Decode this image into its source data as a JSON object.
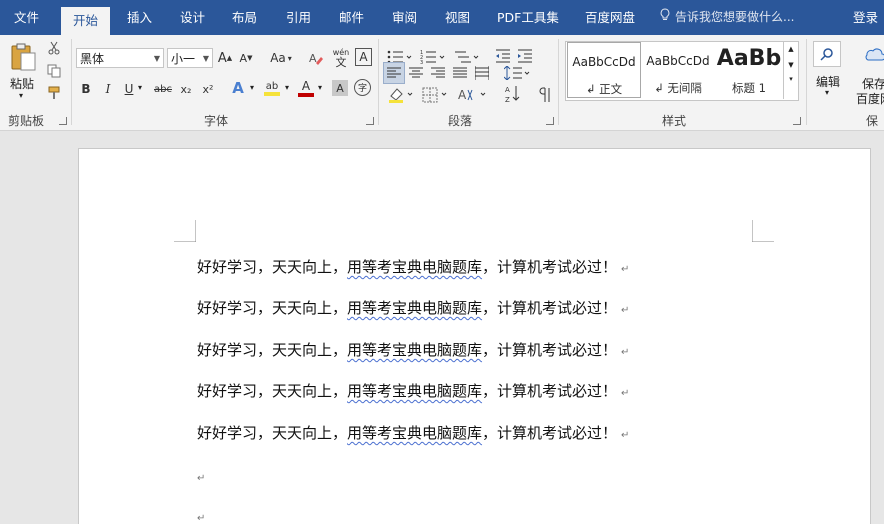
{
  "menubar": {
    "tabs": [
      "文件",
      "开始",
      "插入",
      "设计",
      "布局",
      "引用",
      "邮件",
      "审阅",
      "视图",
      "PDF工具集",
      "百度网盘"
    ],
    "active_tab": "开始",
    "tell_me": "告诉我您想要做什么...",
    "login": "登录"
  },
  "ribbon": {
    "clipboard": {
      "paste": "粘贴",
      "group": "剪贴板"
    },
    "font": {
      "name": "黑体",
      "size": "小一",
      "aa": "Aa",
      "wen": "wén",
      "wen_char": "文",
      "A_box": "A",
      "bold": "B",
      "italic": "I",
      "underline": "U",
      "strike": "abc",
      "sub": "x₂",
      "sup": "x²",
      "clear_a": "A",
      "hl": "ab",
      "color": "A",
      "shade": "A",
      "circle": "字",
      "group": "字体"
    },
    "paragraph": {
      "group": "段落"
    },
    "styles": {
      "group": "样式",
      "items": [
        {
          "sample": "AaBbCcDd",
          "name": "正文"
        },
        {
          "sample": "AaBbCcDd",
          "name": "无间隔"
        },
        {
          "sample": "AaBb",
          "name": "标题 1"
        }
      ]
    },
    "edit": {
      "label": "编辑"
    },
    "save": {
      "label1": "保存",
      "label2": "百度网",
      "group": "保存"
    }
  },
  "document": {
    "line_prefix": "好好学习，天天向上，",
    "line_underlined": "用等考宝典电脑题库",
    "line_suffix": "，计算机考试必过！",
    "lines_count_text": "5",
    "para_mark": "↵"
  }
}
